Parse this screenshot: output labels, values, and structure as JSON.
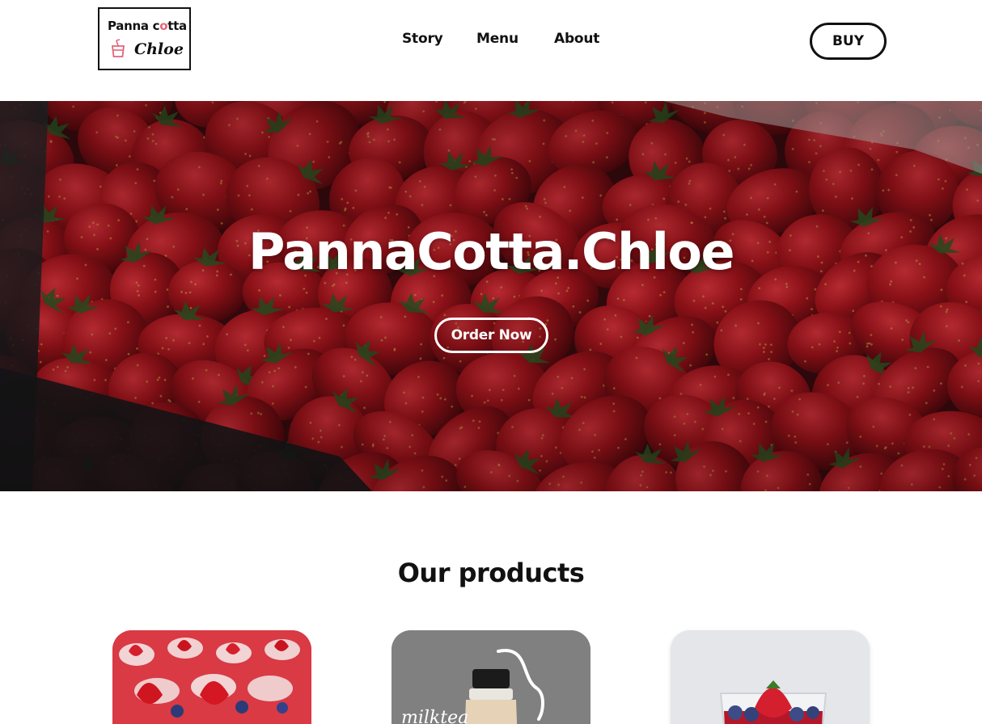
{
  "brand": {
    "logo_line1_prefix": "Panna c",
    "logo_line1_accent": "o",
    "logo_line1_suffix": "tta",
    "logo_line2": "Chloe",
    "logo_cup_icon": "cup-icon",
    "accent_color": "#e2657a"
  },
  "nav": {
    "items": [
      {
        "label": "Story"
      },
      {
        "label": "Menu"
      },
      {
        "label": "About"
      }
    ],
    "buy_label": "BUY"
  },
  "hero": {
    "title": "PannaCotta.Chloe",
    "cta_label": "Order Now",
    "background": "strawberries-photo",
    "strawberry_color": "#b3131d"
  },
  "products": {
    "heading": "Our products",
    "items": [
      {
        "image": "strawberry-panna-cotta-cups"
      },
      {
        "image": "milk-tea-bottle",
        "caption": "milktea"
      },
      {
        "image": "strawberry-blueberry-cup"
      }
    ]
  }
}
